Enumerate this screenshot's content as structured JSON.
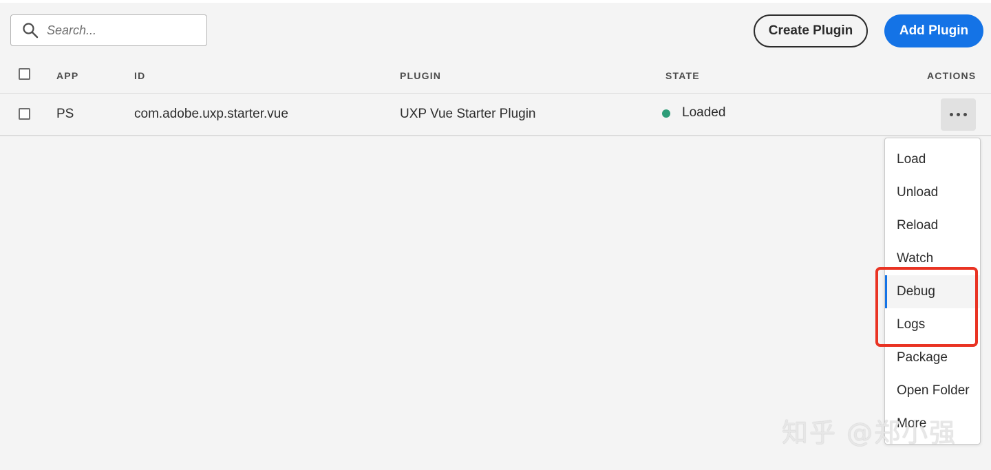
{
  "search": {
    "placeholder": "Search..."
  },
  "header": {
    "create_label": "Create Plugin",
    "add_label": "Add Plugin",
    "accent_color": "#1473e6"
  },
  "table": {
    "columns": {
      "app": "APP",
      "id": "ID",
      "plugin": "PLUGIN",
      "state": "STATE",
      "actions": "ACTIONS"
    },
    "rows": [
      {
        "app": "PS",
        "id": "com.adobe.uxp.starter.vue",
        "plugin": "UXP Vue Starter Plugin",
        "state": "Loaded",
        "state_color": "#2d9d78"
      }
    ]
  },
  "menu": {
    "items": [
      "Load",
      "Unload",
      "Reload",
      "Watch",
      "Debug",
      "Logs",
      "Package",
      "Open Folder",
      "More"
    ],
    "active": "Debug"
  },
  "annotation": {
    "highlight_color": "#e93323"
  },
  "watermark": {
    "text": "知乎 @郑小强"
  },
  "icons": {
    "search": "search-icon",
    "more": "more-icon"
  }
}
